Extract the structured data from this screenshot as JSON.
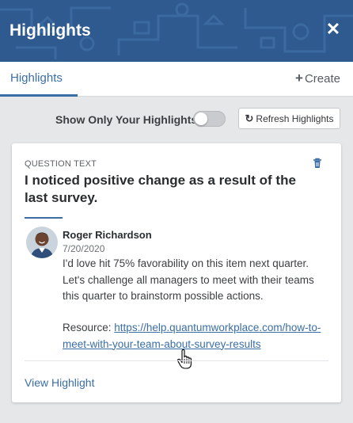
{
  "header": {
    "title": "Highlights",
    "close_icon": "close-icon",
    "background_color": "#2f5a8f"
  },
  "tabs": {
    "highlights_label": "Highlights",
    "create_label": "Create",
    "create_icon": "plus-icon"
  },
  "filter": {
    "toggle_label": "Show Only Your Highlights",
    "toggle_on": false,
    "refresh_label": "Refresh Highlights",
    "refresh_icon": "refresh-icon"
  },
  "highlight": {
    "section_label": "QUESTION TEXT",
    "question": "I noticed positive change as a result of the last survey.",
    "author": "Roger Richardson",
    "date": "7/20/2020",
    "comment": "I'd love hit 75% favorability on this item next quarter. Let's challenge all managers to meet with their teams this quarter to brainstorm possible actions.",
    "resource_label": "Resource:",
    "resource_url": "https://help.quantumworkplace.com/how-to-meet-with-your-team-about-survey-results",
    "view_label": "View Highlight",
    "delete_icon": "trash-icon",
    "accent_color": "#3a6ea5"
  }
}
